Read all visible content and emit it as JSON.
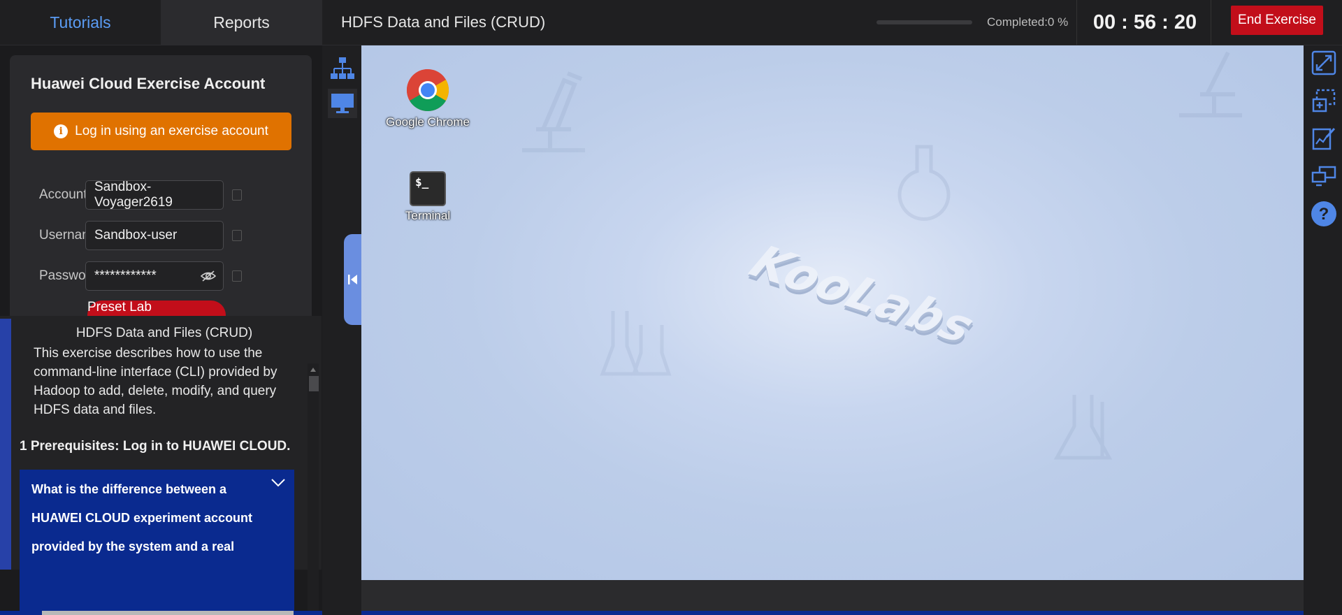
{
  "topbar": {
    "tabs": [
      {
        "label": "Tutorials",
        "active": true
      },
      {
        "label": "Reports",
        "active": false
      }
    ],
    "exercise_title": "HDFS Data and Files  (CRUD)",
    "completed_label": "Completed:0 %",
    "progress_fraction": 0,
    "timer": "00 : 56 : 20",
    "end_button": "End Exercise"
  },
  "account_card": {
    "title": "Huawei Cloud Exercise Account",
    "login_button": "Log in using an exercise account",
    "fields": [
      {
        "label": "Account",
        "value": "Sandbox-Voyager2619"
      },
      {
        "label": "Username",
        "value": "Sandbox-user"
      },
      {
        "label": "Password",
        "value": "************"
      }
    ],
    "preset_button": "Preset Lab Environment"
  },
  "doc": {
    "title": "HDFS Data and Files  (CRUD)",
    "description": "This exercise describes how to use the command-line interface (CLI) provided by Hadoop to add, delete, modify, and query HDFS data and files.",
    "step": "1 Prerequisites: Log in to HUAWEI CLOUD.",
    "faq_question": "What is the difference between a HUAWEI CLOUD experiment account provided by the system and a real"
  },
  "desktop": {
    "icons": [
      {
        "label": "Google Chrome",
        "icon": "chrome-icon"
      },
      {
        "label": "Terminal",
        "icon": "terminal-icon",
        "glyph": "$_"
      }
    ],
    "watermark": "KooLabs"
  },
  "colors": {
    "accent_blue": "#5b9cf4",
    "end_red": "#c20e1a",
    "login_orange": "#e07200",
    "faq_navy": "#0a2a8f"
  }
}
